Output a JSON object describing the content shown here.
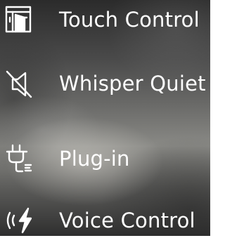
{
  "colors": {
    "text": "#ffffff",
    "icon": "#ffffff"
  },
  "features": [
    {
      "label": "Touch Control",
      "icon": "touch-door-icon"
    },
    {
      "label": "Whisper Quiet",
      "icon": "speaker-muted-icon"
    },
    {
      "label": "Plug-in",
      "icon": "power-plug-icon"
    },
    {
      "label": "Voice Control",
      "icon": "voice-waves-icon"
    }
  ]
}
